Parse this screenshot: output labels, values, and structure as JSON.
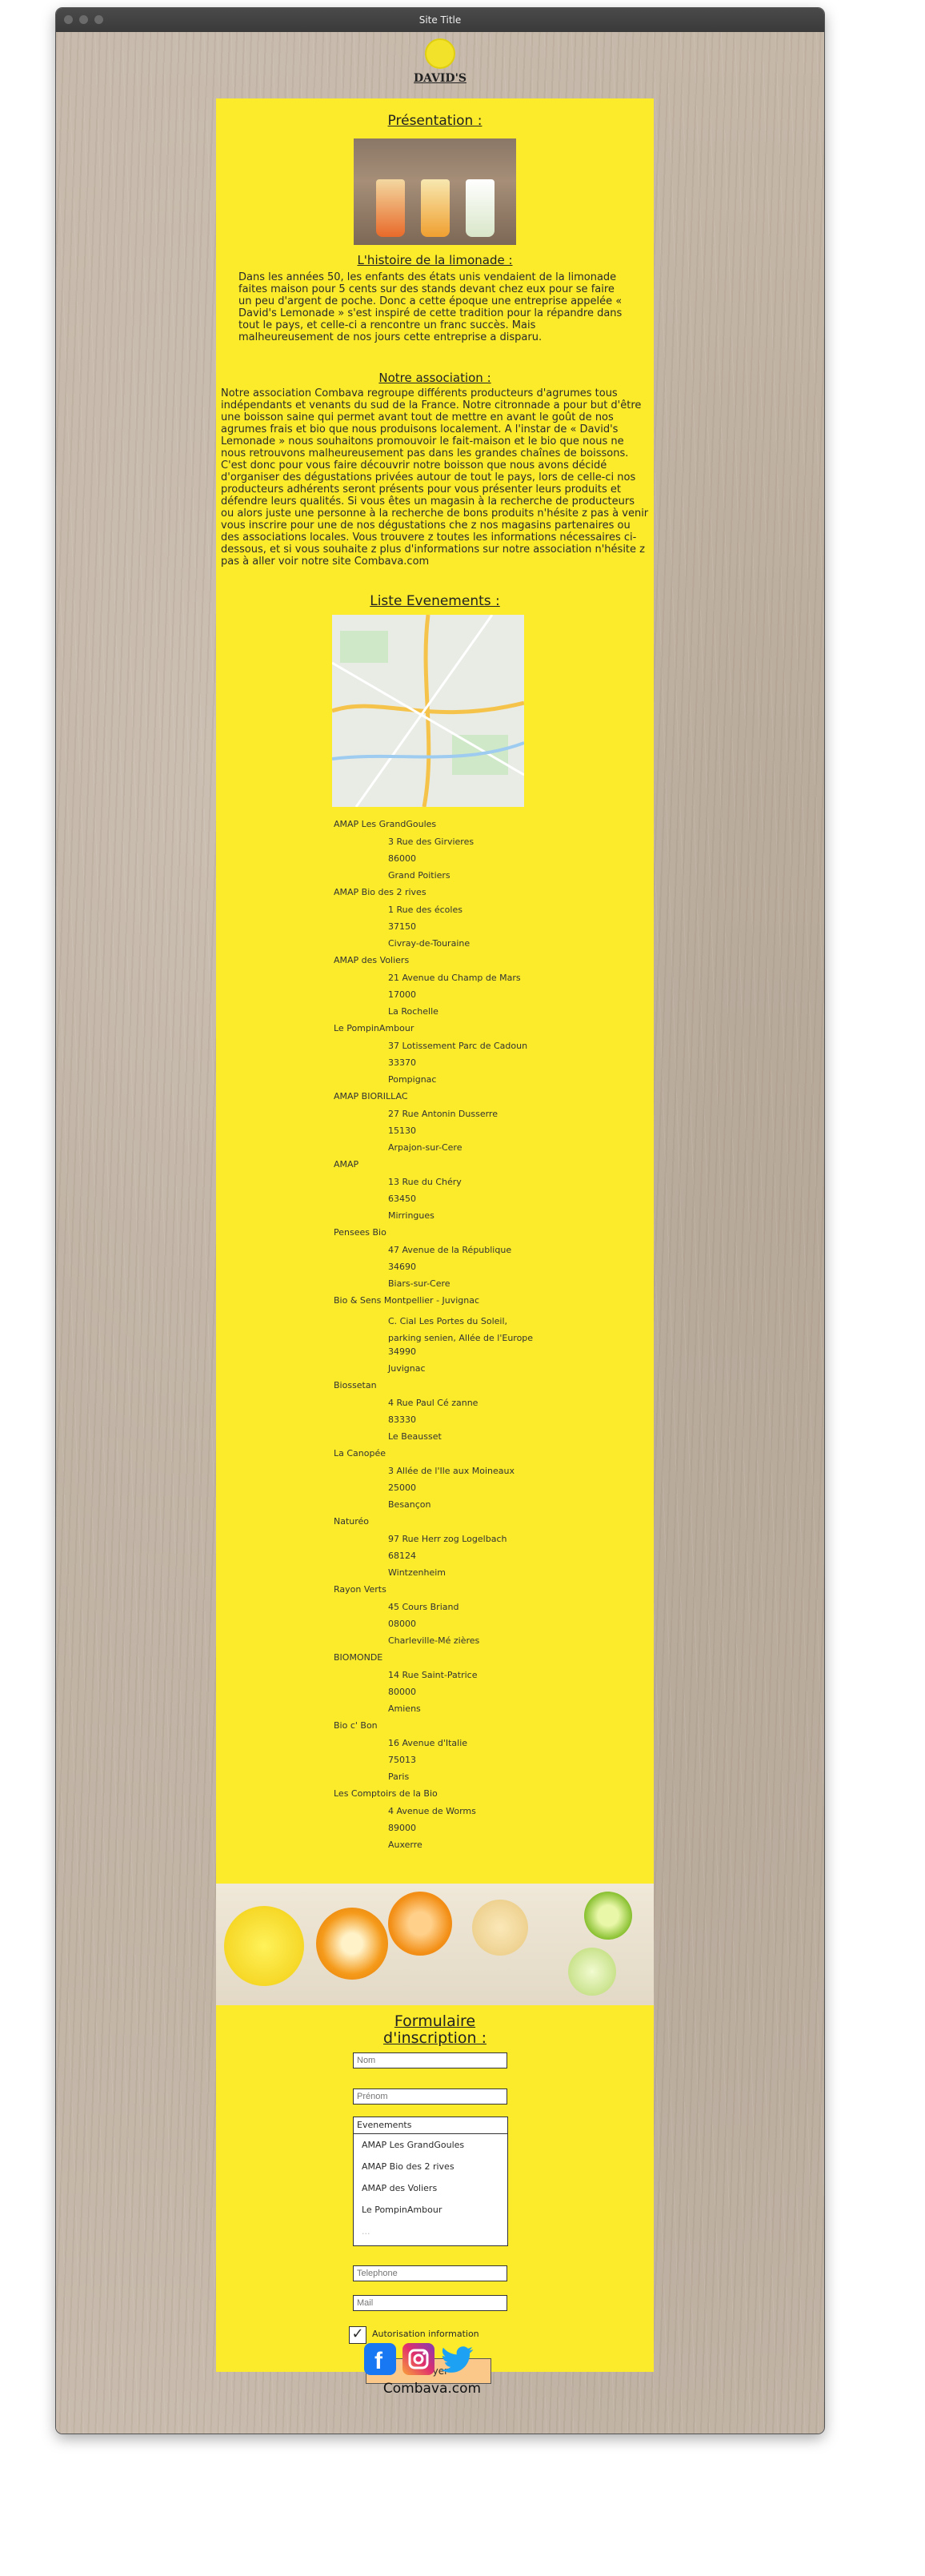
{
  "window": {
    "title": "Site Title"
  },
  "logo": {
    "text": "DAVID'S"
  },
  "presentation": {
    "title": "Présentation :",
    "history_title": "L'histoire de la limonade :",
    "history_text": "Dans les années 50, les enfants des états unis vendaient de la limonade faites maison pour 5 cents sur des stands devant chez eux pour se faire un peu d'argent de poche. Donc a cette époque une entreprise appelée « David's Lemonade » s'est inspiré de cette tradition pour la répandre dans tout le pays, et celle-ci a rencontre un franc succès. Mais malheureusement de nos jours cette entreprise a disparu.",
    "association_title": "Notre association :",
    "association_text": "Notre association Combava regroupe différents producteurs d'agrumes tous indépendants et venants du sud de la France. Notre citronnade a pour but d'être une boisson saine qui permet avant tout de mettre en avant le goût de nos agrumes frais et bio que nous produisons localement. A l'instar de « David's Lemonade » nous souhaitons promouvoir le fait-maison et le bio que nous ne nous retrouvons malheureusement pas dans les grandes chaînes de boissons. C'est donc pour vous faire découvrir notre boisson que nous avons décidé d'organiser des dégustations privées autour de tout le pays, lors de celle-ci nos producteurs adhérents seront présents pour vous présenter leurs produits et défendre leurs qualités. Si vous êtes un magasin à la recherche de producteurs ou alors juste une personne à la recherche de bons produits n'hésite z pas à venir vous inscrire pour une de nos dégustations che z nos magasins partenaires ou des associations locales. Vous trouvere z toutes les informations nécessaires ci-dessous, et si vous souhaite z plus d'informations sur notre association n'hésite z pas à aller voir notre site Combava.com"
  },
  "events": {
    "title": "Liste Evenements :",
    "items": [
      {
        "name": "AMAP Les GrandGoules",
        "street": "3 Rue des Girvieres",
        "zip": "86000",
        "city": "Grand Poitiers"
      },
      {
        "name": "AMAP Bio des 2 rives",
        "street": "1 Rue des écoles",
        "zip": "37150",
        "city": "Civray-de-Touraine"
      },
      {
        "name": "AMAP des Voliers",
        "street": "21 Avenue du Champ de Mars",
        "zip": "17000",
        "city": "La Rochelle"
      },
      {
        "name": "Le PompinAmbour",
        "street": "37 Lotissement Parc de Cadoun",
        "zip": "33370",
        "city": "Pompignac"
      },
      {
        "name": "AMAP BIORILLAC",
        "street": "27 Rue Antonin Dusserre",
        "zip": "15130",
        "city": "Arpajon-sur-Cere"
      },
      {
        "name": "AMAP",
        "street": "13 Rue du Chéry",
        "zip": "63450",
        "city": "Mirringues"
      },
      {
        "name": "Pensees Bio",
        "street": "47 Avenue de la République",
        "zip": "34690",
        "city": "Biars-sur-Cere"
      },
      {
        "name": "Bio & Sens Montpellier - Juvignac",
        "street": "C. Cial Les Portes du Soleil, parking senien, Allée de l'Europe",
        "zip": "34990",
        "city": "Juvignac"
      },
      {
        "name": "Biossetan",
        "street": "4 Rue Paul Cé zanne",
        "zip": "83330",
        "city": "Le Beausset"
      },
      {
        "name": "La Canopée",
        "street": "3 Allée de l'Ile aux Moineaux",
        "zip": "25000",
        "city": "Besançon"
      },
      {
        "name": "Naturéo",
        "street": "97 Rue Herr zog Logelbach",
        "zip": "68124",
        "city": "Wintzenheim"
      },
      {
        "name": "Rayon Verts",
        "street": "45 Cours Briand",
        "zip": "08000",
        "city": "Charleville-Mé zières"
      },
      {
        "name": "BIOMONDE",
        "street": "14 Rue Saint-Patrice",
        "zip": "80000",
        "city": "Amiens"
      },
      {
        "name": "Bio c' Bon",
        "street": "16 Avenue d'Italie",
        "zip": "75013",
        "city": "Paris"
      },
      {
        "name": "Les Comptoirs de la Bio",
        "street": "4 Avenue de Worms",
        "zip": "89000",
        "city": "Auxerre"
      }
    ]
  },
  "form": {
    "title_line1": "Formulaire",
    "title_line2": "d'inscription :",
    "nom_placeholder": "Nom",
    "prenom_placeholder": "Prénom",
    "events_label": "Evenements",
    "events_options": [
      "AMAP Les GrandGoules",
      "AMAP Bio des 2 rives",
      "AMAP des Voliers",
      "Le PompinAmbour",
      "..."
    ],
    "telephone_placeholder": "Telephone",
    "mail_placeholder": "Mail",
    "authorization_label": "Autorisation information",
    "authorization_checked": true,
    "submit_label": "Envoyer"
  },
  "footer": {
    "site": "Combava.com"
  },
  "colors": {
    "panel": "#fbeb2a",
    "button": "#fbc88a",
    "facebook": "#1877f2",
    "twitter": "#1da1f2"
  }
}
